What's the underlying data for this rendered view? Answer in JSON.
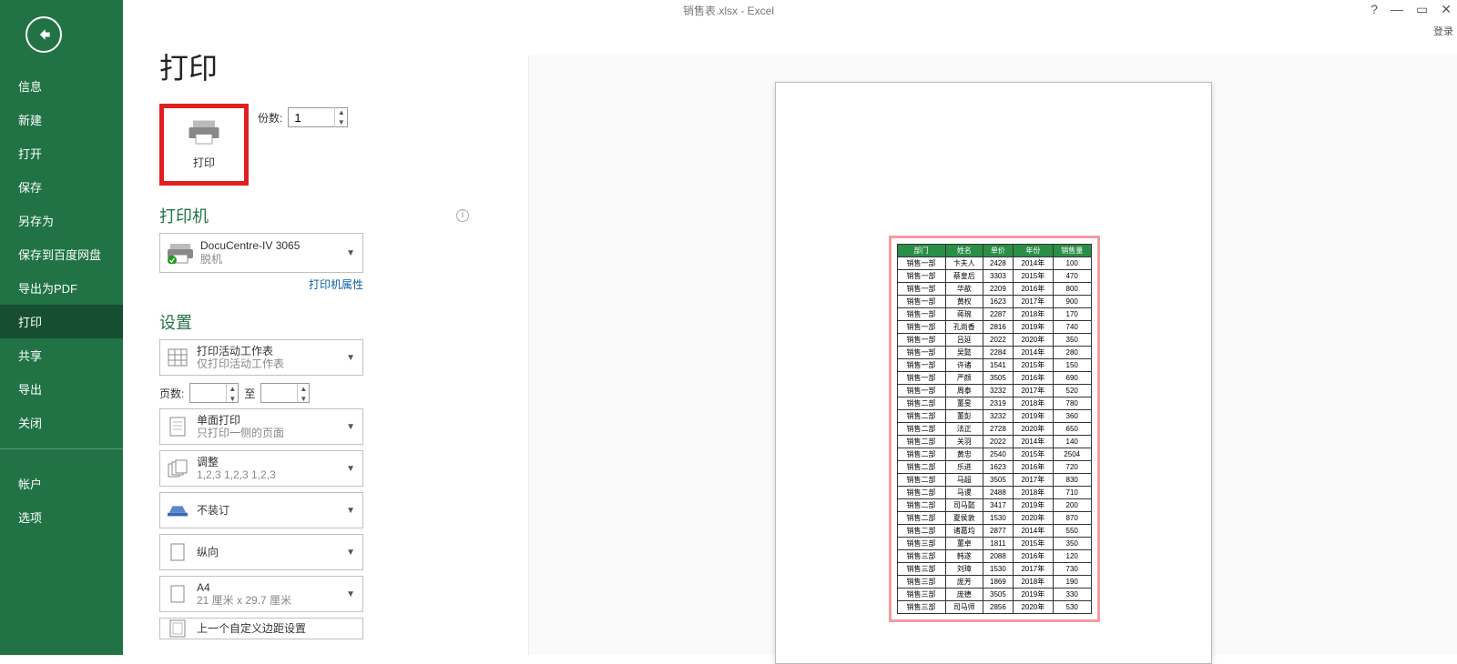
{
  "titlebar": {
    "title": "销售表.xlsx - Excel",
    "login": "登录"
  },
  "sidebar": {
    "items": [
      "信息",
      "新建",
      "打开",
      "保存",
      "另存为",
      "保存到百度网盘",
      "导出为PDF",
      "打印",
      "共享",
      "导出",
      "关闭"
    ],
    "account": "帐户",
    "options": "选项"
  },
  "page": {
    "title": "打印",
    "print_btn": "打印",
    "copies_label": "份数:",
    "copies_value": "1"
  },
  "printer_section": {
    "heading": "打印机",
    "name": "DocuCentre-IV 3065",
    "status": "脱机",
    "properties": "打印机属性"
  },
  "settings": {
    "heading": "设置",
    "scope": {
      "title": "打印活动工作表",
      "sub": "仅打印活动工作表"
    },
    "pages_label": "页数:",
    "to_label": "至",
    "sides": {
      "title": "单面打印",
      "sub": "只打印一侧的页面"
    },
    "collate": {
      "title": "调整",
      "sub": "1,2,3    1,2,3    1,2,3"
    },
    "staple": {
      "title": "不装订"
    },
    "orient": {
      "title": "纵向"
    },
    "paper": {
      "title": "A4",
      "sub": "21 厘米 x 29.7 厘米"
    },
    "margins": {
      "title": "上一个自定义边距设置"
    }
  },
  "chart_data": {
    "type": "table",
    "headers": [
      "部门",
      "姓名",
      "单价",
      "年份",
      "销售量"
    ],
    "rows": [
      [
        "销售一部",
        "卞夫人",
        "2428",
        "2014年",
        "100"
      ],
      [
        "销售一部",
        "蔡皇后",
        "3303",
        "2015年",
        "470"
      ],
      [
        "销售一部",
        "华歆",
        "2209",
        "2016年",
        "800"
      ],
      [
        "销售一部",
        "黄权",
        "1623",
        "2017年",
        "900"
      ],
      [
        "销售一部",
        "蒋琬",
        "2287",
        "2018年",
        "170"
      ],
      [
        "销售一部",
        "孔尚香",
        "2816",
        "2019年",
        "740"
      ],
      [
        "销售一部",
        "吕延",
        "2022",
        "2020年",
        "350"
      ],
      [
        "销售一部",
        "吴懿",
        "2284",
        "2014年",
        "280"
      ],
      [
        "销售一部",
        "许诸",
        "1541",
        "2015年",
        "150"
      ],
      [
        "销售一部",
        "严颜",
        "3505",
        "2016年",
        "690"
      ],
      [
        "销售一部",
        "周泰",
        "3232",
        "2017年",
        "520"
      ],
      [
        "销售二部",
        "董旻",
        "2319",
        "2018年",
        "780"
      ],
      [
        "销售二部",
        "董彭",
        "3232",
        "2019年",
        "360"
      ],
      [
        "销售二部",
        "法正",
        "2728",
        "2020年",
        "650"
      ],
      [
        "销售二部",
        "关羽",
        "2022",
        "2014年",
        "140"
      ],
      [
        "销售二部",
        "黄忠",
        "2540",
        "2015年",
        "2504"
      ],
      [
        "销售二部",
        "乐进",
        "1623",
        "2016年",
        "720"
      ],
      [
        "销售二部",
        "马超",
        "3505",
        "2017年",
        "830"
      ],
      [
        "销售二部",
        "马谡",
        "2488",
        "2018年",
        "710"
      ],
      [
        "销售二部",
        "司马懿",
        "3417",
        "2019年",
        "200"
      ],
      [
        "销售二部",
        "夏侯敦",
        "1530",
        "2020年",
        "870"
      ],
      [
        "销售二部",
        "诸葛均",
        "2877",
        "2014年",
        "550"
      ],
      [
        "销售三部",
        "董卓",
        "1811",
        "2015年",
        "350"
      ],
      [
        "销售三部",
        "韩遂",
        "2088",
        "2016年",
        "120"
      ],
      [
        "销售三部",
        "刘璋",
        "1530",
        "2017年",
        "730"
      ],
      [
        "销售三部",
        "庞芳",
        "1869",
        "2018年",
        "190"
      ],
      [
        "销售三部",
        "庞德",
        "3505",
        "2019年",
        "330"
      ],
      [
        "销售三部",
        "司马师",
        "2856",
        "2020年",
        "530"
      ]
    ]
  }
}
